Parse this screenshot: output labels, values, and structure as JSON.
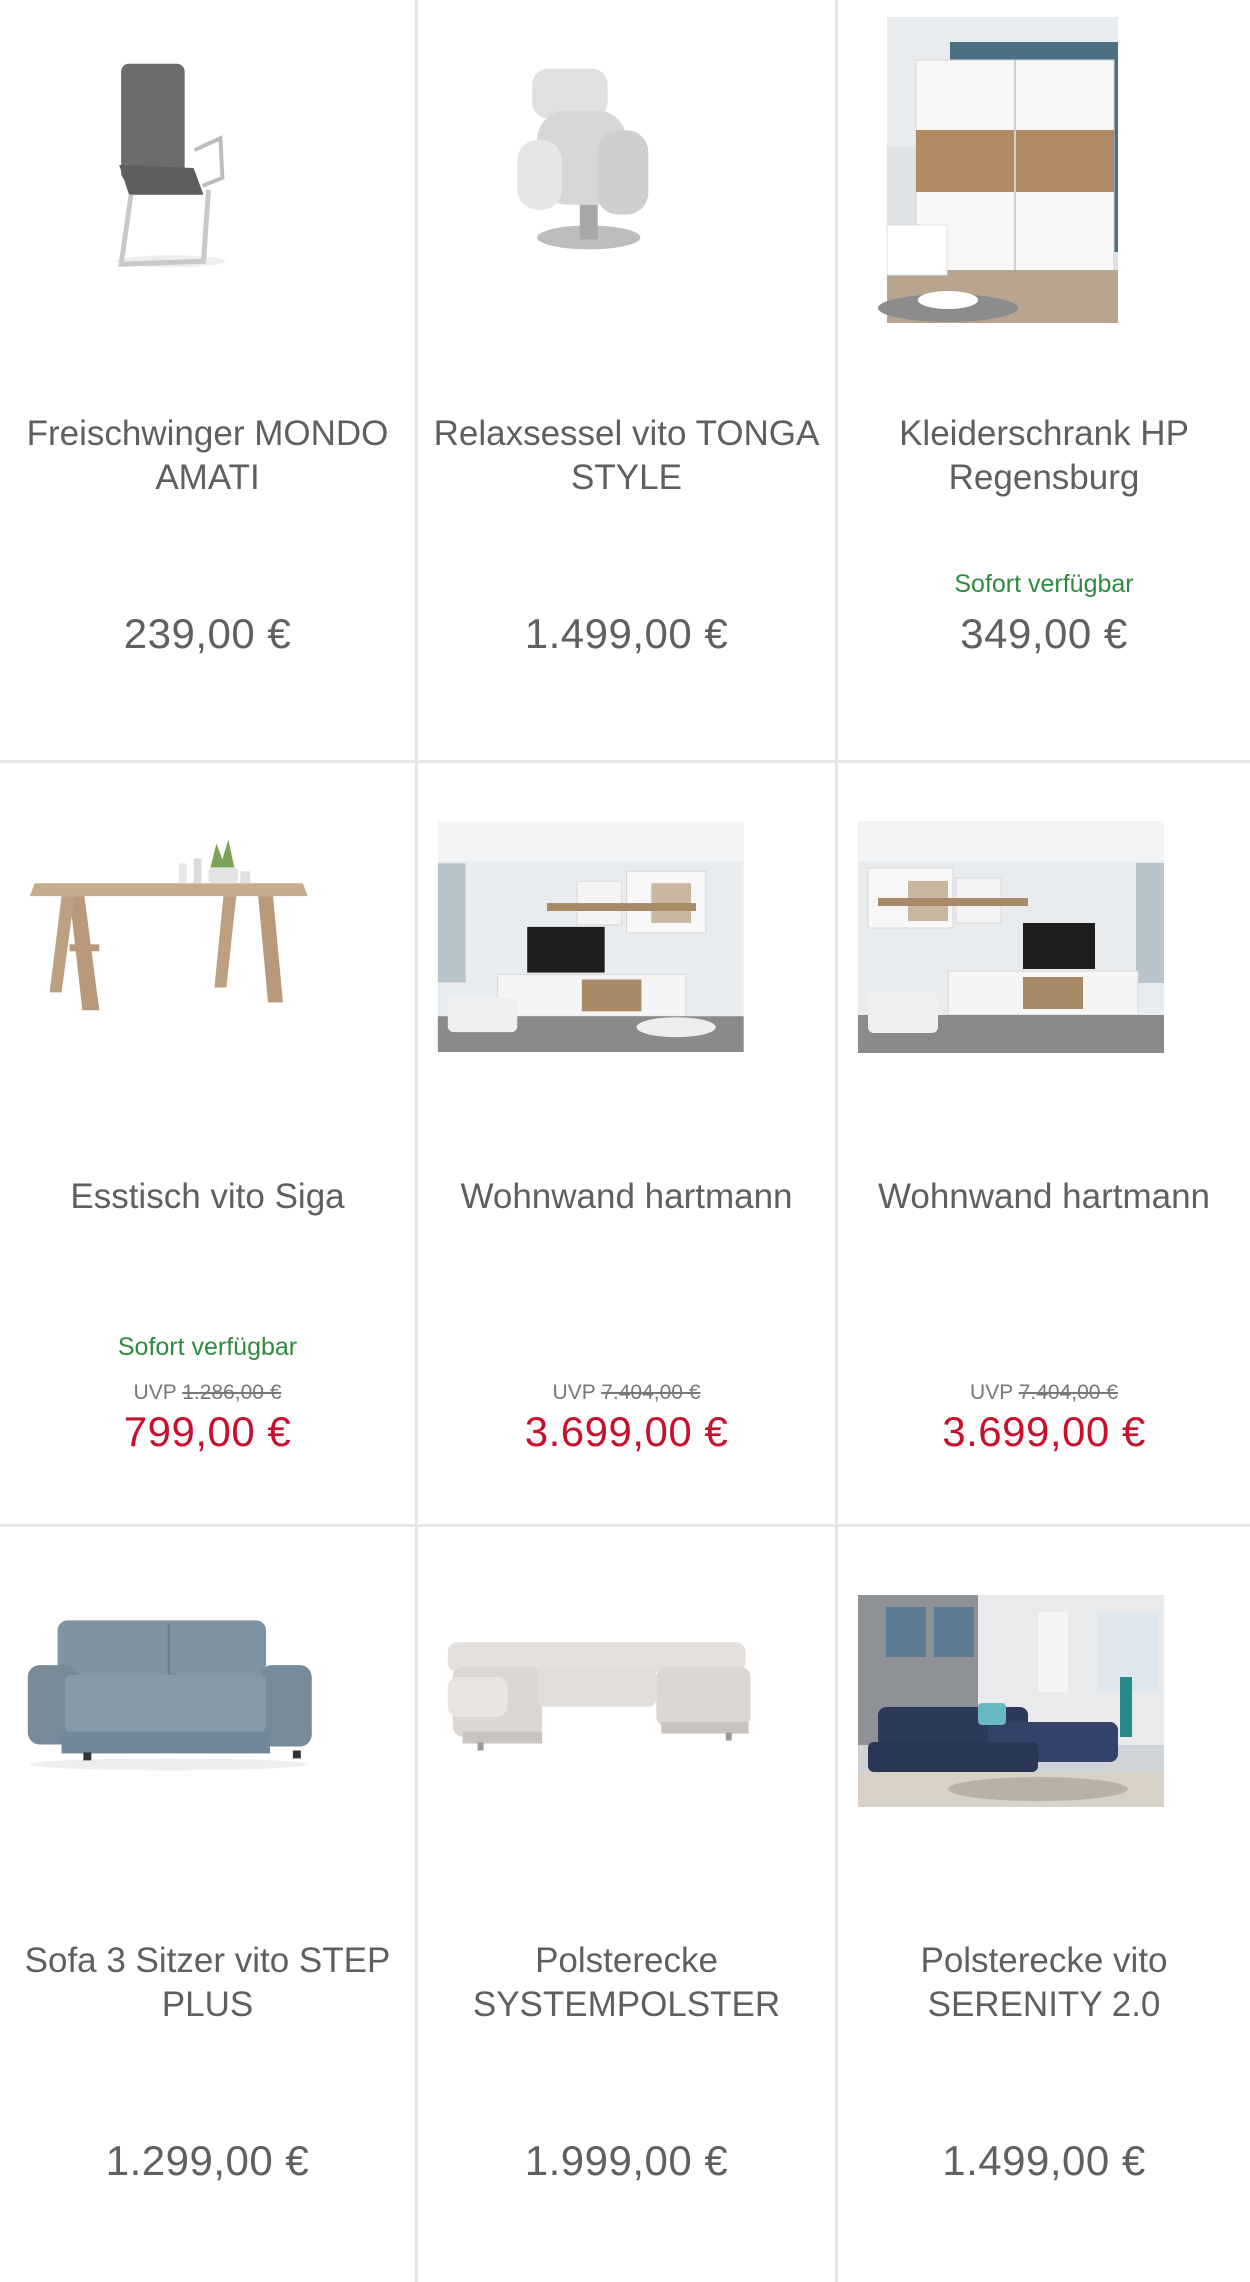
{
  "colors": {
    "sale_price": "#c8102e",
    "available": "#2e8b3e",
    "price": "#606060",
    "divider": "#e6e6e6"
  },
  "products": [
    {
      "name": "Freischwinger MONDO AMATI",
      "image": "cantilever-chair-grey",
      "availability": "",
      "uvp_label": "",
      "uvp_old_price": "",
      "price": "239,00 €"
    },
    {
      "name": "Relaxsessel vito TONGA STYLE",
      "image": "recliner-armchair-light-grey",
      "availability": "",
      "uvp_label": "",
      "uvp_old_price": "",
      "price": "1.499,00 €"
    },
    {
      "name": "Kleiderschrank HP Regensburg",
      "image": "sliding-wardrobe-white-oak",
      "availability": "Sofort verfügbar",
      "uvp_label": "",
      "uvp_old_price": "",
      "price": "349,00 €"
    },
    {
      "name": "Esstisch vito Siga",
      "image": "dining-table-oak",
      "availability": "Sofort verfügbar",
      "uvp_label": "UVP",
      "uvp_old_price": "1.286,00 €",
      "price": "799,00 €"
    },
    {
      "name": "Wohnwand hartmann",
      "image": "living-room-wall-unit",
      "availability": "",
      "uvp_label": "UVP",
      "uvp_old_price": "7.404,00 €",
      "price": "3.699,00 €"
    },
    {
      "name": "Wohnwand hartmann",
      "image": "living-room-wall-unit",
      "availability": "",
      "uvp_label": "UVP",
      "uvp_old_price": "7.404,00 €",
      "price": "3.699,00 €"
    },
    {
      "name": "Sofa 3 Sitzer vito STEP PLUS",
      "image": "three-seater-sofa-blue",
      "availability": "",
      "uvp_label": "",
      "uvp_old_price": "",
      "price": "1.299,00 €"
    },
    {
      "name": "Polsterecke SYSTEMPOLSTER",
      "image": "u-shaped-corner-sofa-white",
      "availability": "",
      "uvp_label": "",
      "uvp_old_price": "",
      "price": "1.999,00 €"
    },
    {
      "name": "Polsterecke vito SERENITY 2.0",
      "image": "corner-sofa-navy-room",
      "availability": "",
      "uvp_label": "",
      "uvp_old_price": "",
      "price": "1.499,00 €"
    }
  ]
}
